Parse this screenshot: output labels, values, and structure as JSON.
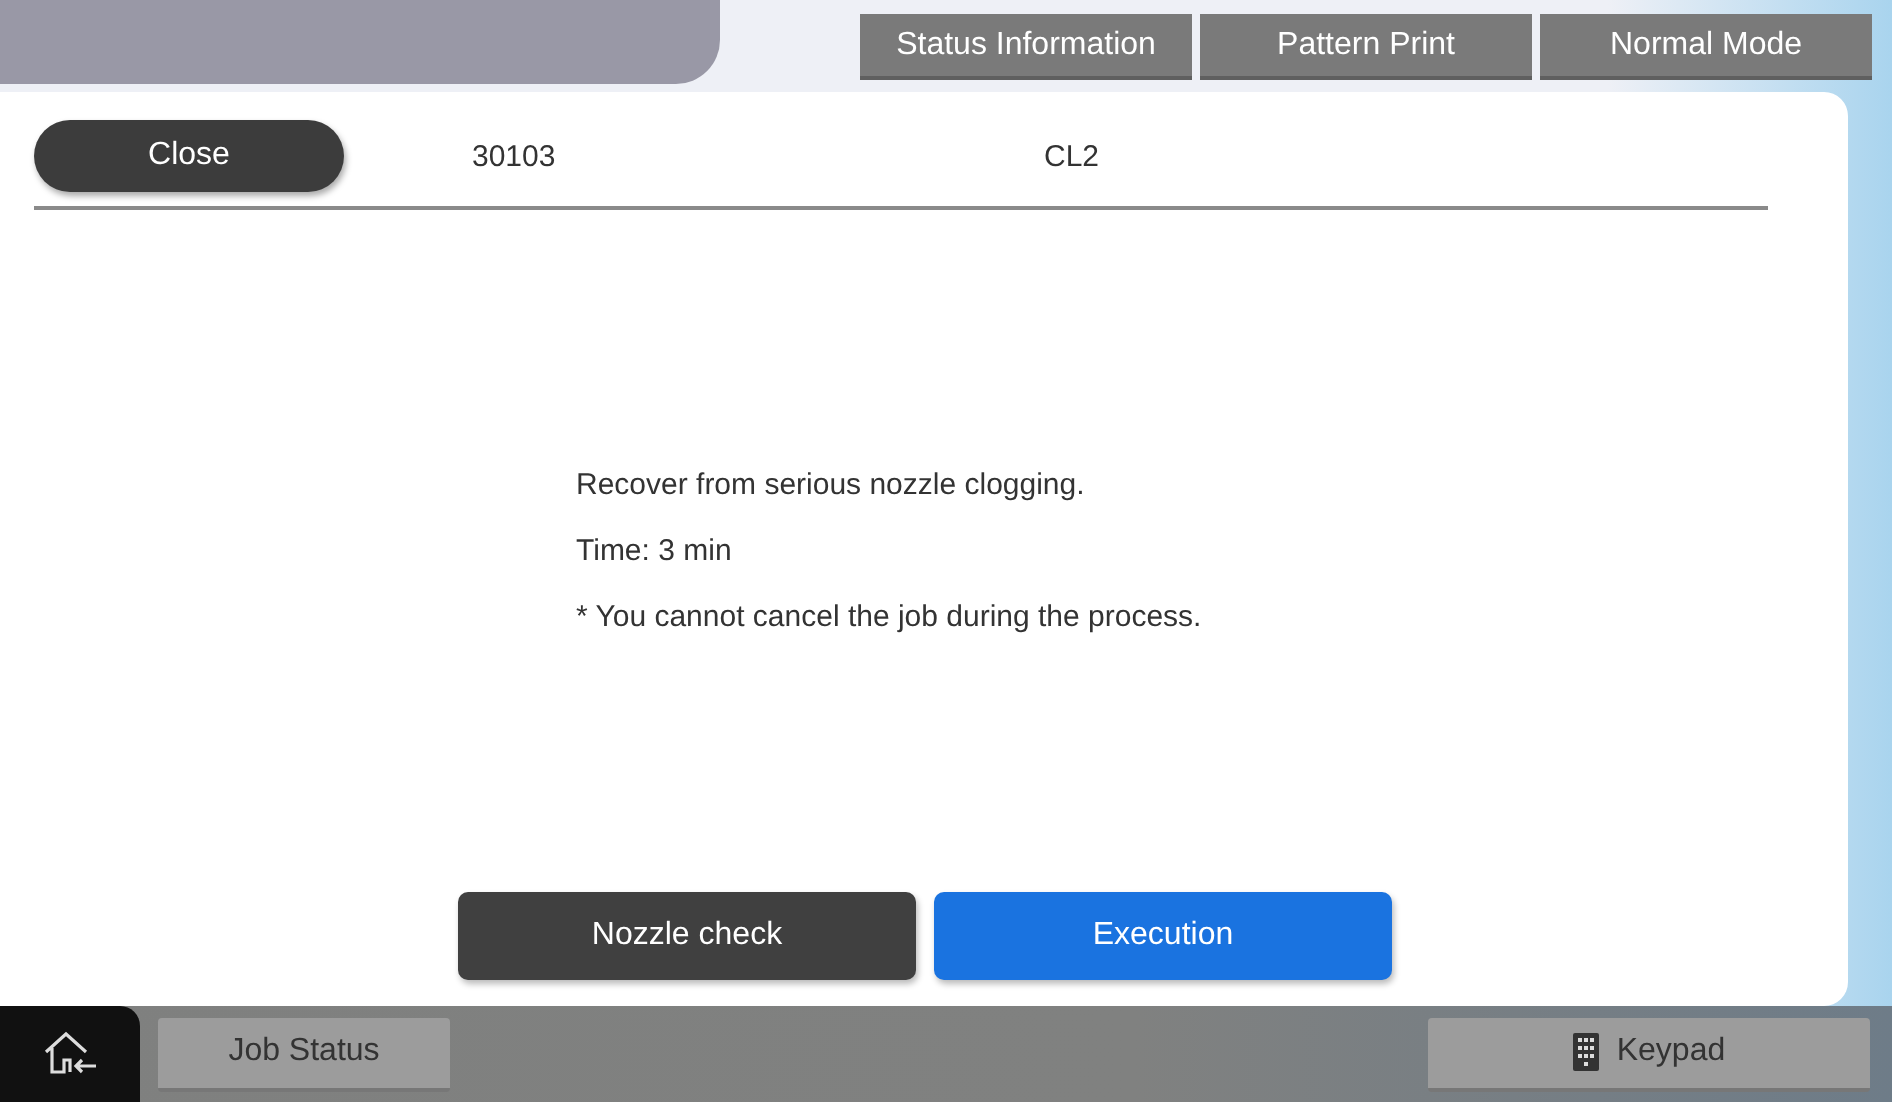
{
  "top_buttons": [
    {
      "label": "Status Information"
    },
    {
      "label": "Pattern Print"
    },
    {
      "label": "Normal Mode"
    }
  ],
  "dialog": {
    "close_button": "Close",
    "code": "30103",
    "target": "CL2",
    "message": [
      "Recover from serious nozzle clogging.",
      "Time: 3 min",
      "* You cannot cancel the job during the process."
    ],
    "actions": [
      {
        "label": "Nozzle check",
        "kind": "secondary"
      },
      {
        "label": "Execution",
        "kind": "primary"
      }
    ]
  },
  "bottom_bar": {
    "job_status": "Job Status",
    "keypad": "Keypad"
  }
}
